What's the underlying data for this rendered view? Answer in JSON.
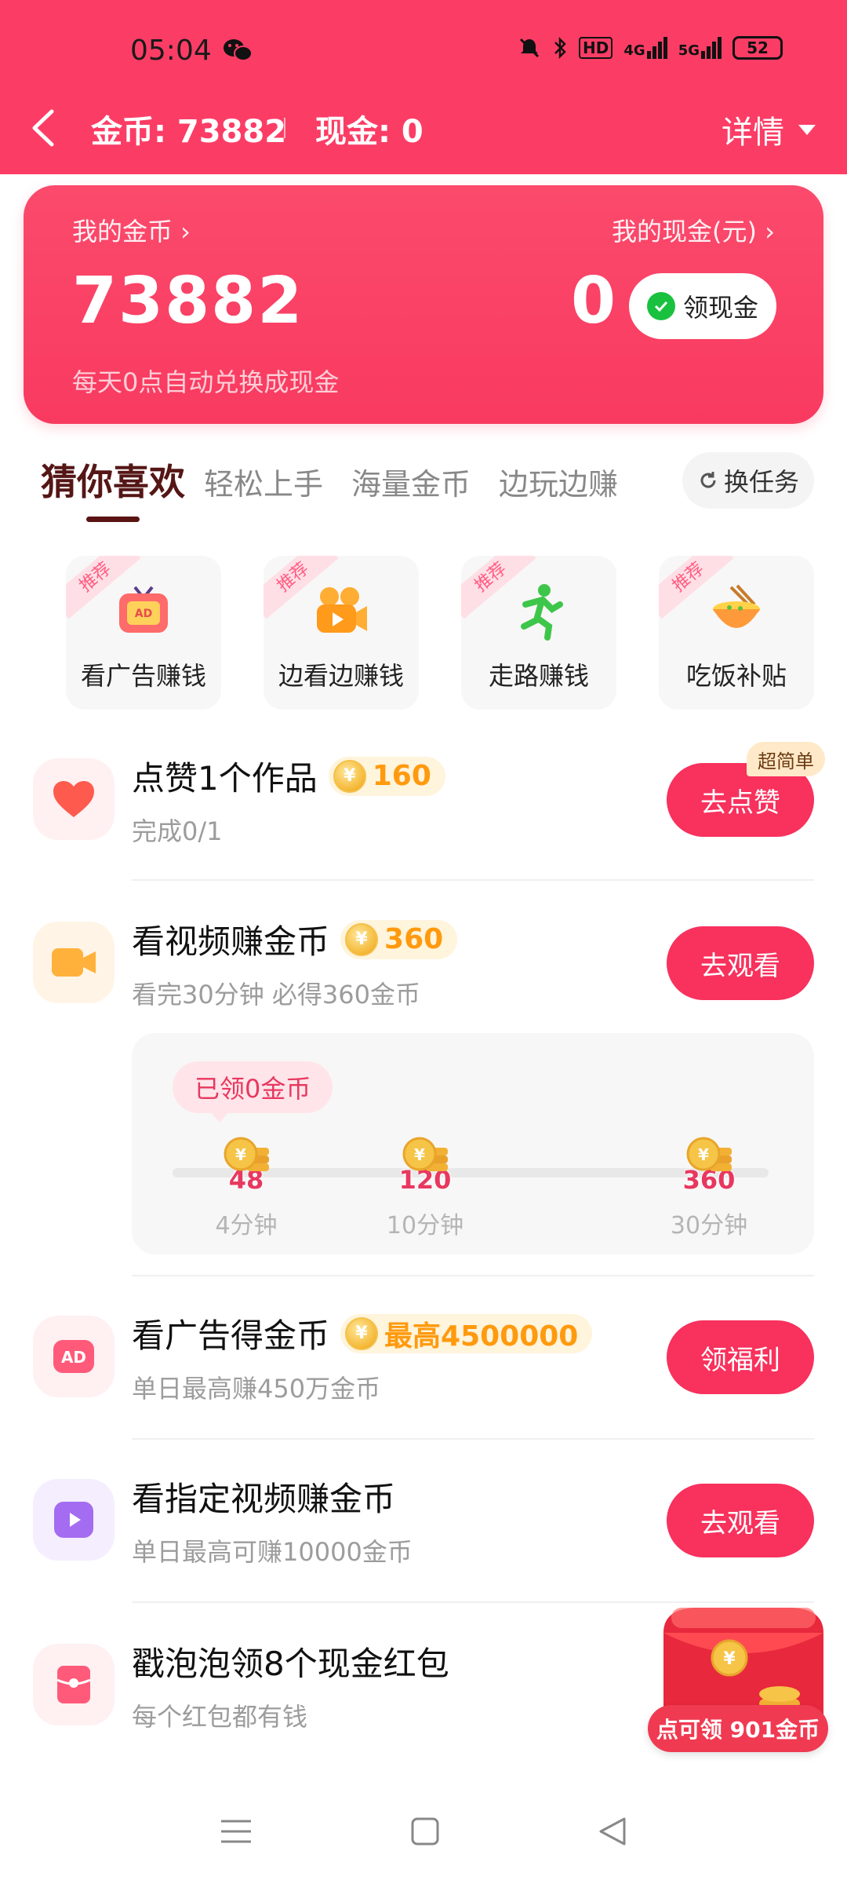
{
  "status": {
    "time": "05:04",
    "right_icons": [
      "mute-icon",
      "bluetooth-icon",
      "hd-icon",
      "4g-signal-icon",
      "5g-signal-icon"
    ],
    "hd": "HD",
    "net1": "4G",
    "net2": "5G",
    "battery": "52"
  },
  "header": {
    "coins": "金币: 73882",
    "cash": "现金: 0",
    "detail": "详情"
  },
  "balance": {
    "my_coins_label": "我的金币 ›",
    "my_cash_label": "我的现金(元) ›",
    "coins_value": "73882",
    "cash_value": "0",
    "withdraw_label": "领现金",
    "note": "每天0点自动兑换成现金"
  },
  "tabs": {
    "items": [
      "猜你喜欢",
      "轻松上手",
      "海量金币",
      "边玩边赚"
    ],
    "switch_label": "换任务"
  },
  "quick": [
    {
      "badge": "推荐",
      "label": "看广告赚钱",
      "icon": "tv-ad-icon"
    },
    {
      "badge": "推荐",
      "label": "边看边赚钱",
      "icon": "camera-icon"
    },
    {
      "badge": "推荐",
      "label": "走路赚钱",
      "icon": "runner-icon"
    },
    {
      "badge": "推荐",
      "label": "吃饭补贴",
      "icon": "bowl-icon"
    }
  ],
  "tasks": {
    "like": {
      "title": "点赞1个作品",
      "reward": "160",
      "sub": "完成0/1",
      "button": "去点赞",
      "tag": "超简单"
    },
    "video": {
      "title": "看视频赚金币",
      "reward": "360",
      "sub": "看完30分钟 必得360金币",
      "button": "去观看"
    },
    "ad": {
      "title": "看广告得金币",
      "reward": "最高4500000",
      "sub": "单日最高赚450万金币",
      "button": "领福利"
    },
    "spec_video": {
      "title": "看指定视频赚金币",
      "sub": "单日最高可赚10000金币",
      "button": "去观看"
    },
    "bubble": {
      "title": "戳泡泡领8个现金红包",
      "sub": "每个红包都有钱"
    }
  },
  "progress": {
    "got": "已领0金币",
    "milestones": [
      {
        "value": "48",
        "time": "4分钟"
      },
      {
        "value": "120",
        "time": "10分钟"
      },
      {
        "value": "360",
        "time": "30分钟"
      }
    ],
    "fraction": 0
  },
  "floating": {
    "chip": "点可领 901金币"
  },
  "colors": {
    "brand": "#fb3d66",
    "button": "#f8315d",
    "reward_bg": "#fff4dc",
    "reward_text": "#ff9a0e"
  }
}
